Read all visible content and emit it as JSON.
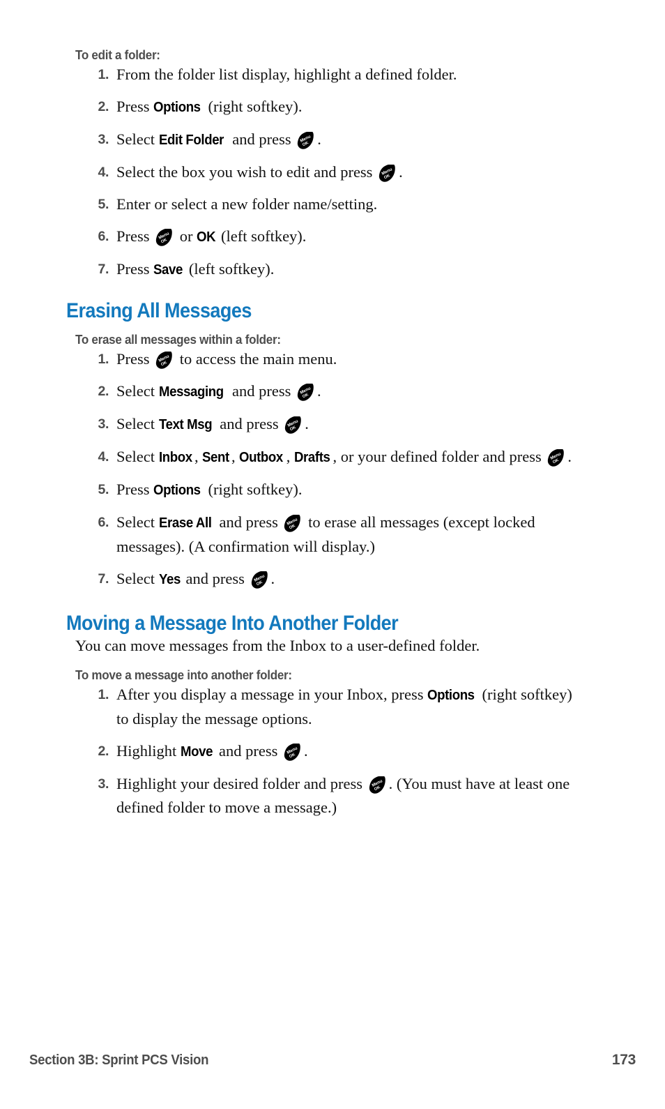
{
  "page": {
    "heading_color": "#1379bd",
    "subheading_color": "#4d4d4d",
    "body_color": "#121212",
    "background": "#ffffff"
  },
  "icons": {
    "menu_ok": {
      "name": "menu-ok-key-icon",
      "line1": "Menu",
      "line2": "OK"
    }
  },
  "sections": [
    {
      "subheading": "To edit a folder:",
      "steps": [
        {
          "num": "1.",
          "parts": [
            {
              "t": "text",
              "v": "From the folder list display, highlight a defined folder."
            }
          ]
        },
        {
          "num": "2.",
          "parts": [
            {
              "t": "text",
              "v": "Press "
            },
            {
              "t": "kw",
              "v": "Options"
            },
            {
              "t": "text",
              "v": " (right softkey)."
            }
          ]
        },
        {
          "num": "3.",
          "parts": [
            {
              "t": "text",
              "v": "Select "
            },
            {
              "t": "kw",
              "v": "Edit Folder"
            },
            {
              "t": "text",
              "v": " and press "
            },
            {
              "t": "icon",
              "v": "menu-ok"
            },
            {
              "t": "text",
              "v": "."
            }
          ]
        },
        {
          "num": "4.",
          "parts": [
            {
              "t": "text",
              "v": "Select the box you wish to edit and press "
            },
            {
              "t": "icon",
              "v": "menu-ok"
            },
            {
              "t": "text",
              "v": "."
            }
          ]
        },
        {
          "num": "5.",
          "parts": [
            {
              "t": "text",
              "v": "Enter or select a new folder name/setting."
            }
          ]
        },
        {
          "num": "6.",
          "parts": [
            {
              "t": "text",
              "v": "Press "
            },
            {
              "t": "icon",
              "v": "menu-ok"
            },
            {
              "t": "text",
              "v": " or "
            },
            {
              "t": "kw",
              "v": "OK"
            },
            {
              "t": "text",
              "v": " (left softkey)."
            }
          ]
        },
        {
          "num": "7.",
          "parts": [
            {
              "t": "text",
              "v": "Press "
            },
            {
              "t": "kw",
              "v": "Save"
            },
            {
              "t": "text",
              "v": " (left softkey)."
            }
          ]
        }
      ]
    },
    {
      "heading": "Erasing All Messages",
      "subheading": "To erase all messages within a folder:",
      "steps": [
        {
          "num": "1.",
          "parts": [
            {
              "t": "text",
              "v": "Press "
            },
            {
              "t": "icon",
              "v": "menu-ok"
            },
            {
              "t": "text",
              "v": " to access the main menu."
            }
          ]
        },
        {
          "num": "2.",
          "parts": [
            {
              "t": "text",
              "v": "Select "
            },
            {
              "t": "kw",
              "v": "Messaging"
            },
            {
              "t": "text",
              "v": " and press "
            },
            {
              "t": "icon",
              "v": "menu-ok"
            },
            {
              "t": "text",
              "v": "."
            }
          ]
        },
        {
          "num": "3.",
          "parts": [
            {
              "t": "text",
              "v": "Select "
            },
            {
              "t": "kw",
              "v": "Text Msg"
            },
            {
              "t": "text",
              "v": " and press "
            },
            {
              "t": "icon",
              "v": "menu-ok"
            },
            {
              "t": "text",
              "v": "."
            }
          ]
        },
        {
          "num": "4.",
          "parts": [
            {
              "t": "text",
              "v": "Select "
            },
            {
              "t": "kw",
              "v": "Inbox"
            },
            {
              "t": "text",
              "v": ", "
            },
            {
              "t": "kw",
              "v": "Sent"
            },
            {
              "t": "text",
              "v": ", "
            },
            {
              "t": "kw",
              "v": "Outbox"
            },
            {
              "t": "text",
              "v": ", "
            },
            {
              "t": "kw",
              "v": "Drafts"
            },
            {
              "t": "text",
              "v": ", or your defined folder and press "
            },
            {
              "t": "icon",
              "v": "menu-ok"
            },
            {
              "t": "text",
              "v": "."
            }
          ]
        },
        {
          "num": "5.",
          "parts": [
            {
              "t": "text",
              "v": "Press "
            },
            {
              "t": "kw",
              "v": "Options"
            },
            {
              "t": "text",
              "v": " (right softkey)."
            }
          ]
        },
        {
          "num": "6.",
          "parts": [
            {
              "t": "text",
              "v": "Select "
            },
            {
              "t": "kw",
              "v": "Erase All"
            },
            {
              "t": "text",
              "v": " and press "
            },
            {
              "t": "icon",
              "v": "menu-ok"
            },
            {
              "t": "text",
              "v": " to erase all messages (except locked messages). (A confirmation will display.)"
            }
          ]
        },
        {
          "num": "7.",
          "parts": [
            {
              "t": "text",
              "v": "Select "
            },
            {
              "t": "kw",
              "v": "Yes"
            },
            {
              "t": "text",
              "v": " and press "
            },
            {
              "t": "icon",
              "v": "menu-ok"
            },
            {
              "t": "text",
              "v": "."
            }
          ]
        }
      ]
    },
    {
      "heading": "Moving a Message Into Another Folder",
      "body": "You can move messages from the Inbox to a user-defined folder.",
      "subheading": "To move a message into another folder:",
      "steps": [
        {
          "num": "1.",
          "parts": [
            {
              "t": "text",
              "v": "After you display a message in your Inbox, press "
            },
            {
              "t": "kw",
              "v": "Options"
            },
            {
              "t": "text",
              "v": " (right softkey) to display the message options."
            }
          ]
        },
        {
          "num": "2.",
          "parts": [
            {
              "t": "text",
              "v": "Highlight "
            },
            {
              "t": "kw",
              "v": "Move"
            },
            {
              "t": "text",
              "v": " and press "
            },
            {
              "t": "icon",
              "v": "menu-ok"
            },
            {
              "t": "text",
              "v": "."
            }
          ]
        },
        {
          "num": "3.",
          "parts": [
            {
              "t": "text",
              "v": "Highlight your desired folder and press "
            },
            {
              "t": "icon",
              "v": "menu-ok"
            },
            {
              "t": "text",
              "v": ". (You must have at least one defined folder to move a message.)"
            }
          ]
        }
      ]
    }
  ],
  "footer": {
    "section_label": "Section 3B: Sprint PCS Vision",
    "page_number": "173"
  }
}
